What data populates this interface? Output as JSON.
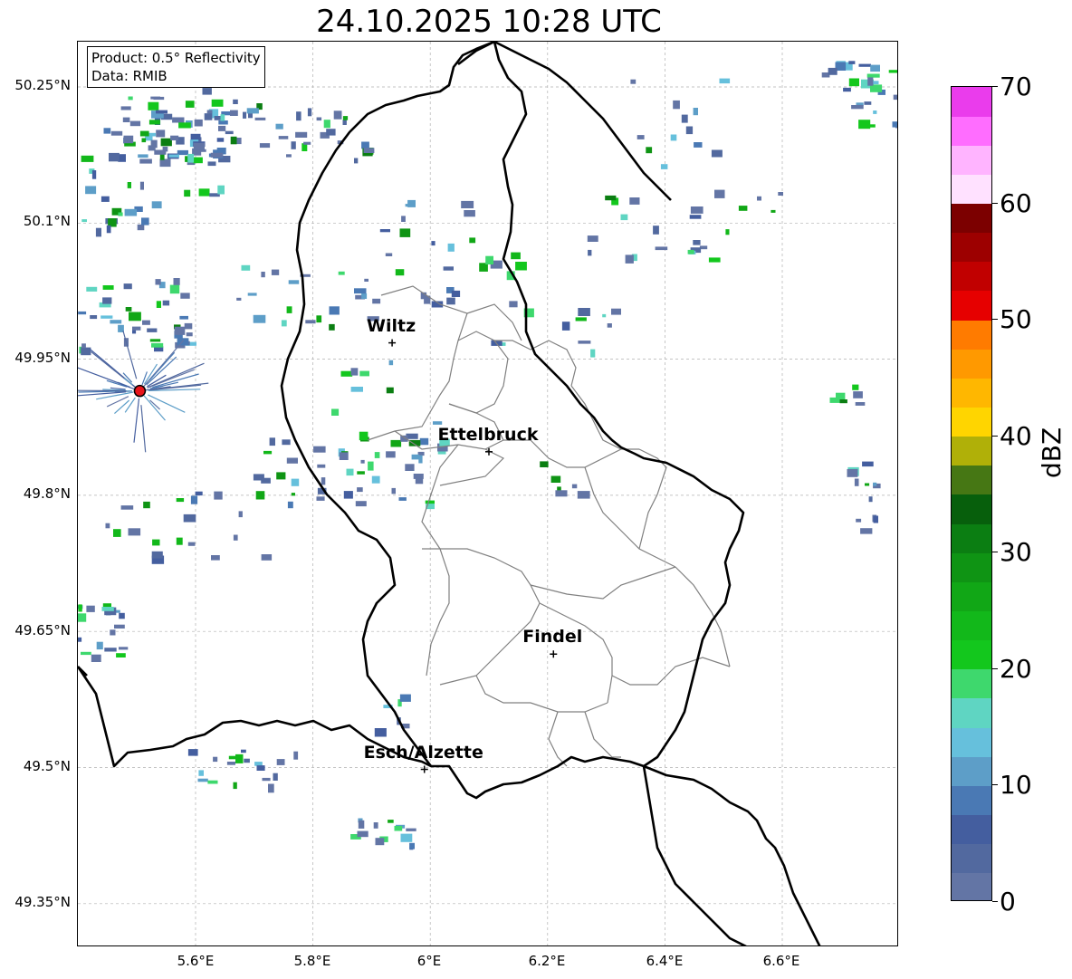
{
  "title": "24.10.2025 10:28 UTC",
  "info": {
    "product": "Product: 0.5° Reflectivity",
    "data": "Data: RMIB"
  },
  "latitude_labels": [
    "50.25°N",
    "50.1°N",
    "49.95°N",
    "49.8°N",
    "49.65°N",
    "49.5°N",
    "49.35°N"
  ],
  "longitude_labels": [
    "5.6°E",
    "5.8°E",
    "6°E",
    "6.2°E",
    "6.4°E",
    "6.6°E"
  ],
  "cities": [
    {
      "name": "Wiltz",
      "lon": 5.935,
      "lat": 49.968
    },
    {
      "name": "Ettelbruck",
      "lon": 6.1,
      "lat": 49.848
    },
    {
      "name": "Findel",
      "lon": 6.21,
      "lat": 49.625
    },
    {
      "name": "Esch/Alzette",
      "lon": 5.99,
      "lat": 49.498
    }
  ],
  "radar_site": {
    "lon": 5.505,
    "lat": 49.915,
    "color": "#e8151b"
  },
  "colorbar": {
    "label": "dBZ",
    "min": 0,
    "max": 70,
    "ticks": [
      "0",
      "10",
      "20",
      "30",
      "40",
      "50",
      "60",
      "70"
    ],
    "colors": [
      "#6375a5",
      "#52699f",
      "#445e9f",
      "#4a79b4",
      "#5d9ec8",
      "#66c0dc",
      "#5fd5c2",
      "#3ed86d",
      "#13c71d",
      "#12b81a",
      "#11a716",
      "#0f9414",
      "#0b7e12",
      "#075f0c",
      "#467714",
      "#b0b008",
      "#ffd500",
      "#ffb700",
      "#ff9900",
      "#ff7b00",
      "#e60000",
      "#c10000",
      "#9d0000",
      "#7c0000",
      "#ffe1ff",
      "#ffb4ff",
      "#ff6dff",
      "#ea3cec"
    ]
  },
  "colors": {
    "border": "#000000",
    "admin_border": "#808080",
    "grid": "#b0b0b0"
  }
}
